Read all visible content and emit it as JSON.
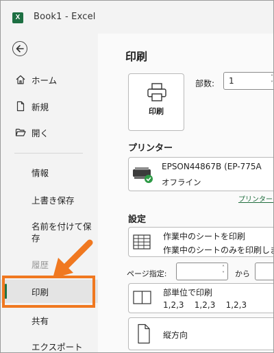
{
  "window": {
    "app_icon": "excel-logo",
    "title": "Book1  -  Excel"
  },
  "nav": {
    "back_icon": "back-arrow-icon",
    "items": [
      {
        "label": "ホーム",
        "icon": "home-icon"
      },
      {
        "label": "新規",
        "icon": "new-document-icon"
      },
      {
        "label": "開く",
        "icon": "open-folder-icon"
      },
      {
        "label": "情報"
      },
      {
        "label": "上書き保存"
      },
      {
        "label": "名前を付けて保\n存"
      },
      {
        "label": "履歴",
        "state": "disabled"
      },
      {
        "label": "印刷",
        "state": "selected"
      },
      {
        "label": "共有"
      },
      {
        "label": "エクスポート"
      }
    ],
    "highlight_color": "#f07820"
  },
  "print": {
    "title": "印刷",
    "button_label": "印刷",
    "button_icon": "printer-icon",
    "copies_label": "部数:",
    "copies_value": "1"
  },
  "printer": {
    "section_title": "プリンター",
    "name": "EPSON44867B (EP-775A",
    "status": "オフライン",
    "status_icon": "check-badge-icon",
    "properties_link": "プリンターの"
  },
  "settings": {
    "section_title": "設定",
    "scope": {
      "line1": "作業中のシートを印刷",
      "line2": "作業中のシートのみを印刷しま",
      "icon": "sheet-grid-icon"
    },
    "pages_label": "ページ指定:",
    "pages_from_label": "から",
    "collate": {
      "line1": "部単位で印刷",
      "line2": "1,2,3    1,2,3    1,2,3",
      "icon": "collate-icon"
    },
    "orientation": {
      "line1": "縦方向",
      "icon": "portrait-page-icon"
    }
  },
  "colors": {
    "accent_green": "#1f7246",
    "annotation_orange": "#f07820"
  }
}
